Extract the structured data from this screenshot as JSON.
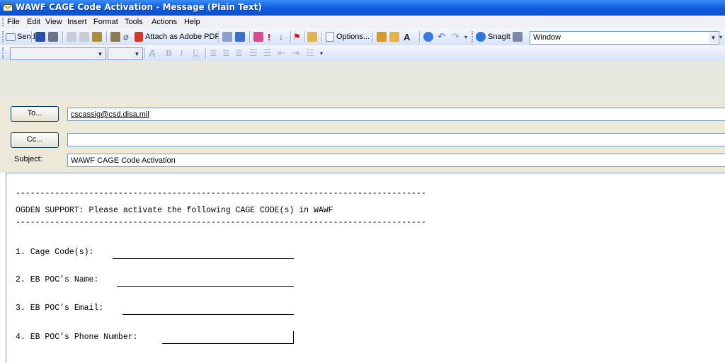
{
  "window": {
    "title": "WAWF CAGE Code Activation - Message (Plain Text)"
  },
  "menu": [
    "File",
    "Edit",
    "View",
    "Insert",
    "Format",
    "Tools",
    "Actions",
    "Help"
  ],
  "toolbar": {
    "send": "Send",
    "attach_pdf": "Attach as Adobe PDF",
    "options": "Options...",
    "snagit": "SnagIt",
    "window_select": "Window"
  },
  "header": {
    "to_label": "To...",
    "to_value": "cscassig@csd.disa.mil",
    "cc_label": "Cc...",
    "cc_value": "",
    "subject_label": "Subject:",
    "subject_value": "WAWF CAGE Code Activation"
  },
  "body": {
    "divider": "------------------------------------------------------------------------------------",
    "intro": "OGDEN SUPPORT: Please activate the following CAGE CODE(s) in WAWF",
    "items": [
      "1. Cage Code(s):",
      "2. EB POC's Name:",
      "3. EB POC's Email:",
      "4. EB POC's Phone Number:"
    ]
  },
  "colors": {
    "titlebar": "#1160e2",
    "toolbar": "#d6e2f8",
    "header_bg": "#ece9d8"
  }
}
